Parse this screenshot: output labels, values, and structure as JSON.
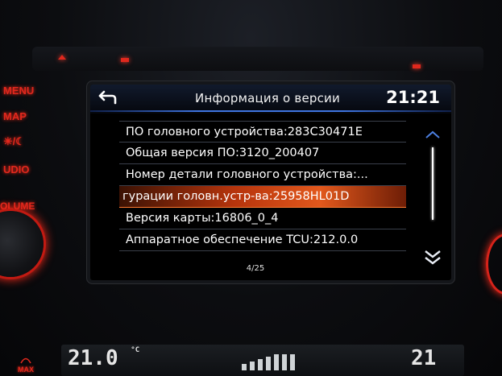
{
  "header": {
    "back_icon": "back-arrow-icon",
    "title": "Информация о версии",
    "clock": "21:21"
  },
  "items": [
    {
      "label": "ПО головного устройства:283C30471E"
    },
    {
      "label": "Общая версия ПО:3120_200407"
    },
    {
      "label": "Номер детали головного устройства:..."
    },
    {
      "label": "гурации головн.устр-ва:25958HL01D"
    },
    {
      "label": "Версия карты:16806_0_4"
    },
    {
      "label": "Аппаратное обеспечение TCU:212.0.0"
    }
  ],
  "selected_index": 3,
  "pagination": "4/25",
  "side_buttons": {
    "menu": "MENU",
    "map": "MAP",
    "day_night": "☀/☾",
    "audio": "UDIO",
    "volume": "OLUME"
  },
  "climate": {
    "left_temp": "21.0",
    "right_temp": "21",
    "unit": "°C",
    "max_label": "MAX"
  },
  "colors": {
    "accent_blue": "#3e74e0",
    "selection_orange": "#e2581c",
    "button_red": "#e0281d"
  }
}
